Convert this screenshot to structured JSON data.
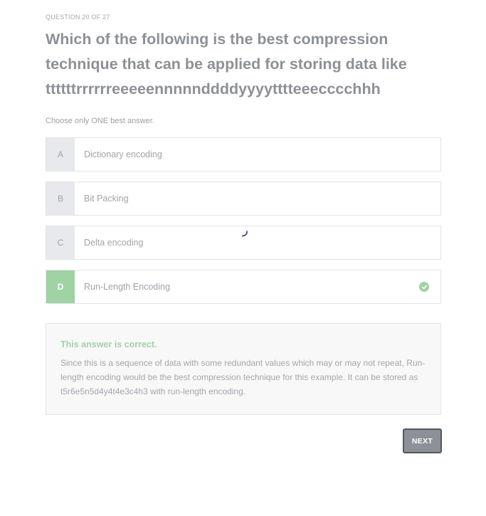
{
  "quiz": {
    "counter": "QUESTION 20 OF 27",
    "question": "Which of the following is the best compression technique that can be applied for storing data like ttttttrrrrrreeeeennnnnddddyyyytttteeecccchhh",
    "instruction": "Choose only ONE best answer.",
    "options": [
      {
        "letter": "A",
        "label": "Dictionary encoding"
      },
      {
        "letter": "B",
        "label": "Bit Packing"
      },
      {
        "letter": "C",
        "label": "Delta encoding"
      },
      {
        "letter": "D",
        "label": "Run-Length Encoding",
        "selected": true,
        "correct": true
      }
    ]
  },
  "feedback": {
    "title": "This answer is correct.",
    "text": "Since this is a sequence of data with some redundant values which may or may not repeat, Run-length encoding would be the best compression technique for this example. It can be stored as t5r6e5n5d4y4t4e3c4h3 with run-length encoding."
  },
  "actions": {
    "next_label": "NEXT"
  },
  "colors": {
    "correct": "#9fd3a3",
    "letter_bg": "#e8e9ec",
    "button_bg": "#8e9097",
    "button_border": "#55575d"
  },
  "icons": {
    "correct_mark": "check-circle-icon"
  }
}
